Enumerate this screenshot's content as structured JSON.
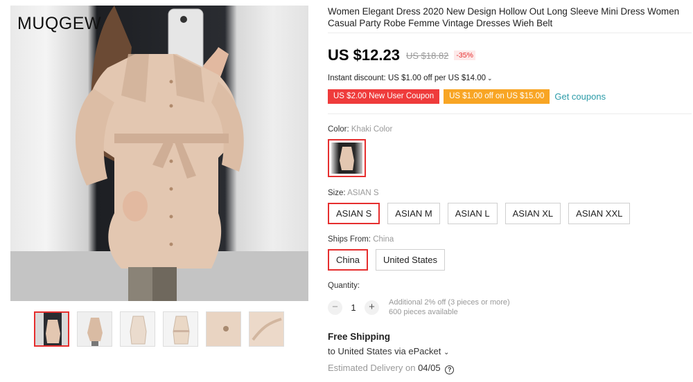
{
  "gallery": {
    "brand": "MUQGEW",
    "thumbnails": [
      "thumb-1",
      "thumb-2",
      "thumb-3",
      "thumb-4",
      "thumb-5",
      "thumb-6"
    ],
    "active_index": 0
  },
  "product": {
    "title": "Women Elegant Dress 2020 New Design Hollow Out Long Sleeve Mini Dress Women Casual Party Robe Femme Vintage Dresses Wieh Belt",
    "price": "US $12.23",
    "old_price": "US $18.82",
    "discount": "-35%",
    "instant_discount": "Instant discount: US $1.00 off per US $14.00",
    "instant_chevron": "⌄",
    "coupon_new_user": "US $2.00 New User Coupon",
    "coupon_store": "US $1.00 off on US $15.00",
    "get_coupons": "Get coupons"
  },
  "color": {
    "label": "Color: ",
    "value": "Khaki Color"
  },
  "size": {
    "label": "Size: ",
    "value": "ASIAN S",
    "options": [
      "ASIAN S",
      "ASIAN M",
      "ASIAN L",
      "ASIAN XL",
      "ASIAN XXL"
    ],
    "selected": "ASIAN S"
  },
  "ships_from": {
    "label": "Ships From: ",
    "value": "China",
    "options": [
      "China",
      "United States"
    ],
    "selected": "China"
  },
  "quantity": {
    "label": "Quantity:",
    "minus": "−",
    "plus": "+",
    "value": "1",
    "note1": "Additional 2% off (3 pieces or more)",
    "note2": "600 pieces available"
  },
  "shipping": {
    "title": "Free Shipping",
    "to": "to United States via ePacket",
    "chevron": "⌄",
    "est_label": "Estimated Delivery on ",
    "est_date": "04/05",
    "help_icon": "?"
  },
  "colors": {
    "accent_red": "#e62e2e",
    "coupon_red": "#ef3b3b",
    "coupon_orange": "#f8a524",
    "link_teal": "#2b9ba8"
  }
}
